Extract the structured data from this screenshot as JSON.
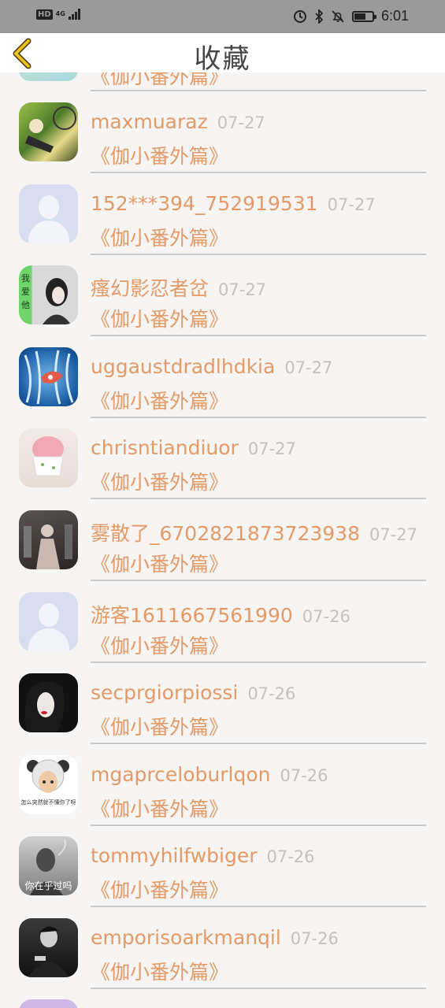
{
  "status_bar": {
    "hd": "HD",
    "network": "4G",
    "time": "6:01"
  },
  "header": {
    "title": "收藏"
  },
  "partial_top": {
    "subtitle": "《伽小番外篇》"
  },
  "items": [
    {
      "name": "maxmuaraz",
      "date": "07-27",
      "subtitle": "《伽小番外篇》"
    },
    {
      "name": "152***394_752919531",
      "date": "07-27",
      "subtitle": "《伽小番外篇》"
    },
    {
      "name": "瘙幻影忍者岔",
      "date": "07-27",
      "subtitle": "《伽小番外篇》",
      "avatar_text": "我爱他"
    },
    {
      "name": "uggaustdradlhdkia",
      "date": "07-27",
      "subtitle": "《伽小番外篇》"
    },
    {
      "name": "chrisntiandiuor",
      "date": "07-27",
      "subtitle": "《伽小番外篇》"
    },
    {
      "name": "雾散了_6702821873723938",
      "date": "07-27",
      "subtitle": "《伽小番外篇》"
    },
    {
      "name": "游客1611667561990",
      "date": "07-26",
      "subtitle": "《伽小番外篇》"
    },
    {
      "name": "secprgiorpiossi",
      "date": "07-26",
      "subtitle": "《伽小番外篇》"
    },
    {
      "name": "mgaprceloburlqon",
      "date": "07-26",
      "subtitle": "《伽小番外篇》",
      "avatar_text": "怎么突然就不懂你了呀"
    },
    {
      "name": "tommyhilfwbiger",
      "date": "07-26",
      "subtitle": "《伽小番外篇》",
      "avatar_text": "你在乎过吗"
    },
    {
      "name": "emporisoarkmanqil",
      "date": "07-26",
      "subtitle": "《伽小番外篇》"
    }
  ],
  "colors": {
    "accent": "#e39a66",
    "date": "#c7c0bf",
    "background": "#f7f4f4",
    "back_arrow": "#e8c11e"
  }
}
